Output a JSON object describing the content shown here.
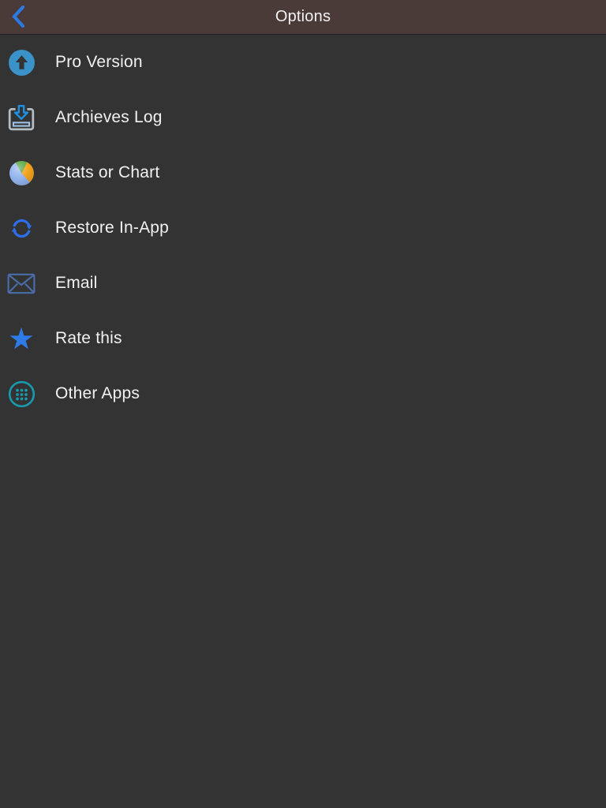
{
  "header": {
    "title": "Options",
    "back_icon": "chevron-left",
    "background_color": "#4a3a38",
    "accent_color": "#2b7ae2"
  },
  "theme": {
    "screen_background": "#333333",
    "label_color": "#f1f1f1"
  },
  "list": {
    "items": [
      {
        "label": "Pro Version",
        "icon": "upgrade-arrow-circle-icon",
        "icon_color": "#3b92c8"
      },
      {
        "label": "Archieves Log",
        "icon": "archive-tray-icon",
        "icon_color": "#1f8fe0"
      },
      {
        "label": "Stats or Chart",
        "icon": "pie-chart-icon",
        "icon_color": "#93b4ef"
      },
      {
        "label": "Restore In-App",
        "icon": "refresh-arrows-icon",
        "icon_color": "#2d6ee8"
      },
      {
        "label": "Email",
        "icon": "envelope-icon",
        "icon_color": "#4a6da8"
      },
      {
        "label": "Rate this",
        "icon": "star-icon",
        "icon_color": "#2e7ce8"
      },
      {
        "label": "Other Apps",
        "icon": "dots-grid-circle-icon",
        "icon_color": "#1999ac"
      }
    ]
  }
}
